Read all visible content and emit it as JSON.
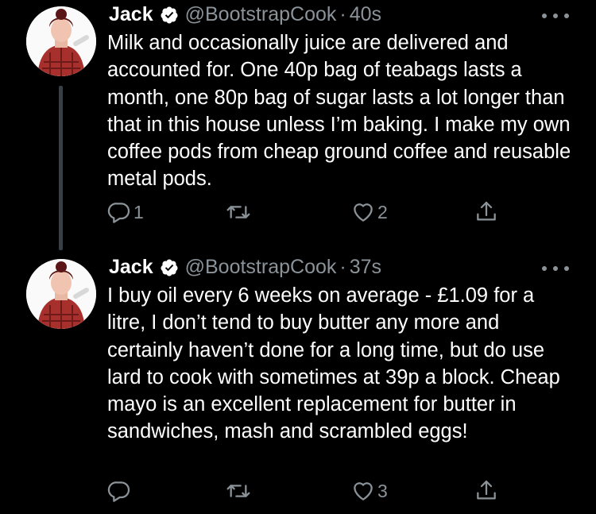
{
  "tweets": [
    {
      "name": "Jack",
      "handle": "@BootstrapCook",
      "separator": "·",
      "time": "40s",
      "text": "Milk and occasionally juice are delivered and accounted for. One 40p bag of teabags lasts a month, one 80p bag of sugar lasts a lot longer than that in this house unless I’m baking. I make my own coffee pods from cheap ground coffee and reusable metal pods.",
      "reply_count": "1",
      "retweet_count": "",
      "like_count": "2"
    },
    {
      "name": "Jack",
      "handle": "@BootstrapCook",
      "separator": "·",
      "time": "37s",
      "text": "I buy oil every 6 weeks on average - £1.09 for a litre, I don’t tend to buy butter any more and certainly haven’t done for a long time, but do use lard to cook with sometimes at 39p a block. Cheap mayo is an excellent replacement for butter in sandwiches, mash and scrambled eggs!",
      "reply_count": "",
      "retweet_count": "",
      "like_count": "3"
    }
  ],
  "colors": {
    "background": "#000000",
    "text": "#ffffff",
    "secondary": "#8b9399",
    "thread_line": "#3a3f44",
    "verified_badge": "#ffffff"
  },
  "icons": [
    "verified-badge-icon",
    "more-options-icon",
    "reply-icon",
    "retweet-icon",
    "like-icon",
    "share-icon"
  ]
}
